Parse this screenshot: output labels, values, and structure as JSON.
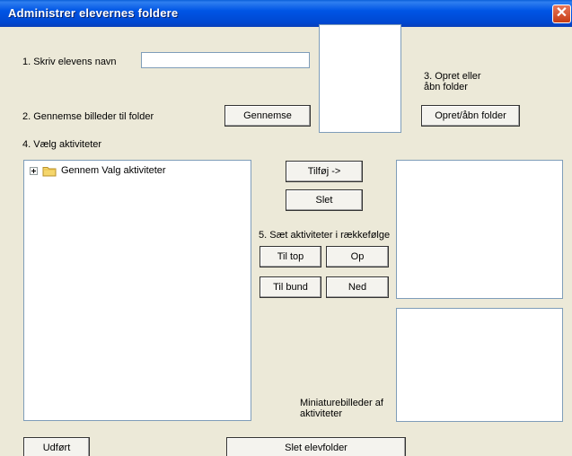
{
  "window": {
    "title": "Administrer elevernes foldere"
  },
  "step1": {
    "label": "1. Skriv elevens navn",
    "name_value": ""
  },
  "step2": {
    "label": "2. Gennemse billeder til folder",
    "browse_label": "Gennemse"
  },
  "step3": {
    "label_line1": "3. Opret eller",
    "label_line2": "åbn folder",
    "open_label": "Opret/åbn folder"
  },
  "step4": {
    "label": "4. Vælg aktiviteter",
    "tree": [
      {
        "label": "Gennem Valg aktiviteter",
        "icon": "folder-icon",
        "expander": "plus"
      }
    ]
  },
  "buttons": {
    "add_label": "Tilføj ->",
    "delete_label": "Slet",
    "to_top_label": "Til top",
    "up_label": "Op",
    "to_bottom_label": "Til bund",
    "down_label": "Ned",
    "done_label": "Udført",
    "delete_folder_label": "Slet elevfolder"
  },
  "step5": {
    "label": "5. Sæt aktiviteter i rækkefølge"
  },
  "thumbnails": {
    "label_line1": "Miniaturebilleder af",
    "label_line2": "aktiviteter"
  },
  "colors": {
    "background": "#ece9d8",
    "titlebar": "#0055e5",
    "close_button": "#c63c14",
    "folder_icon": "#f5d66b"
  }
}
